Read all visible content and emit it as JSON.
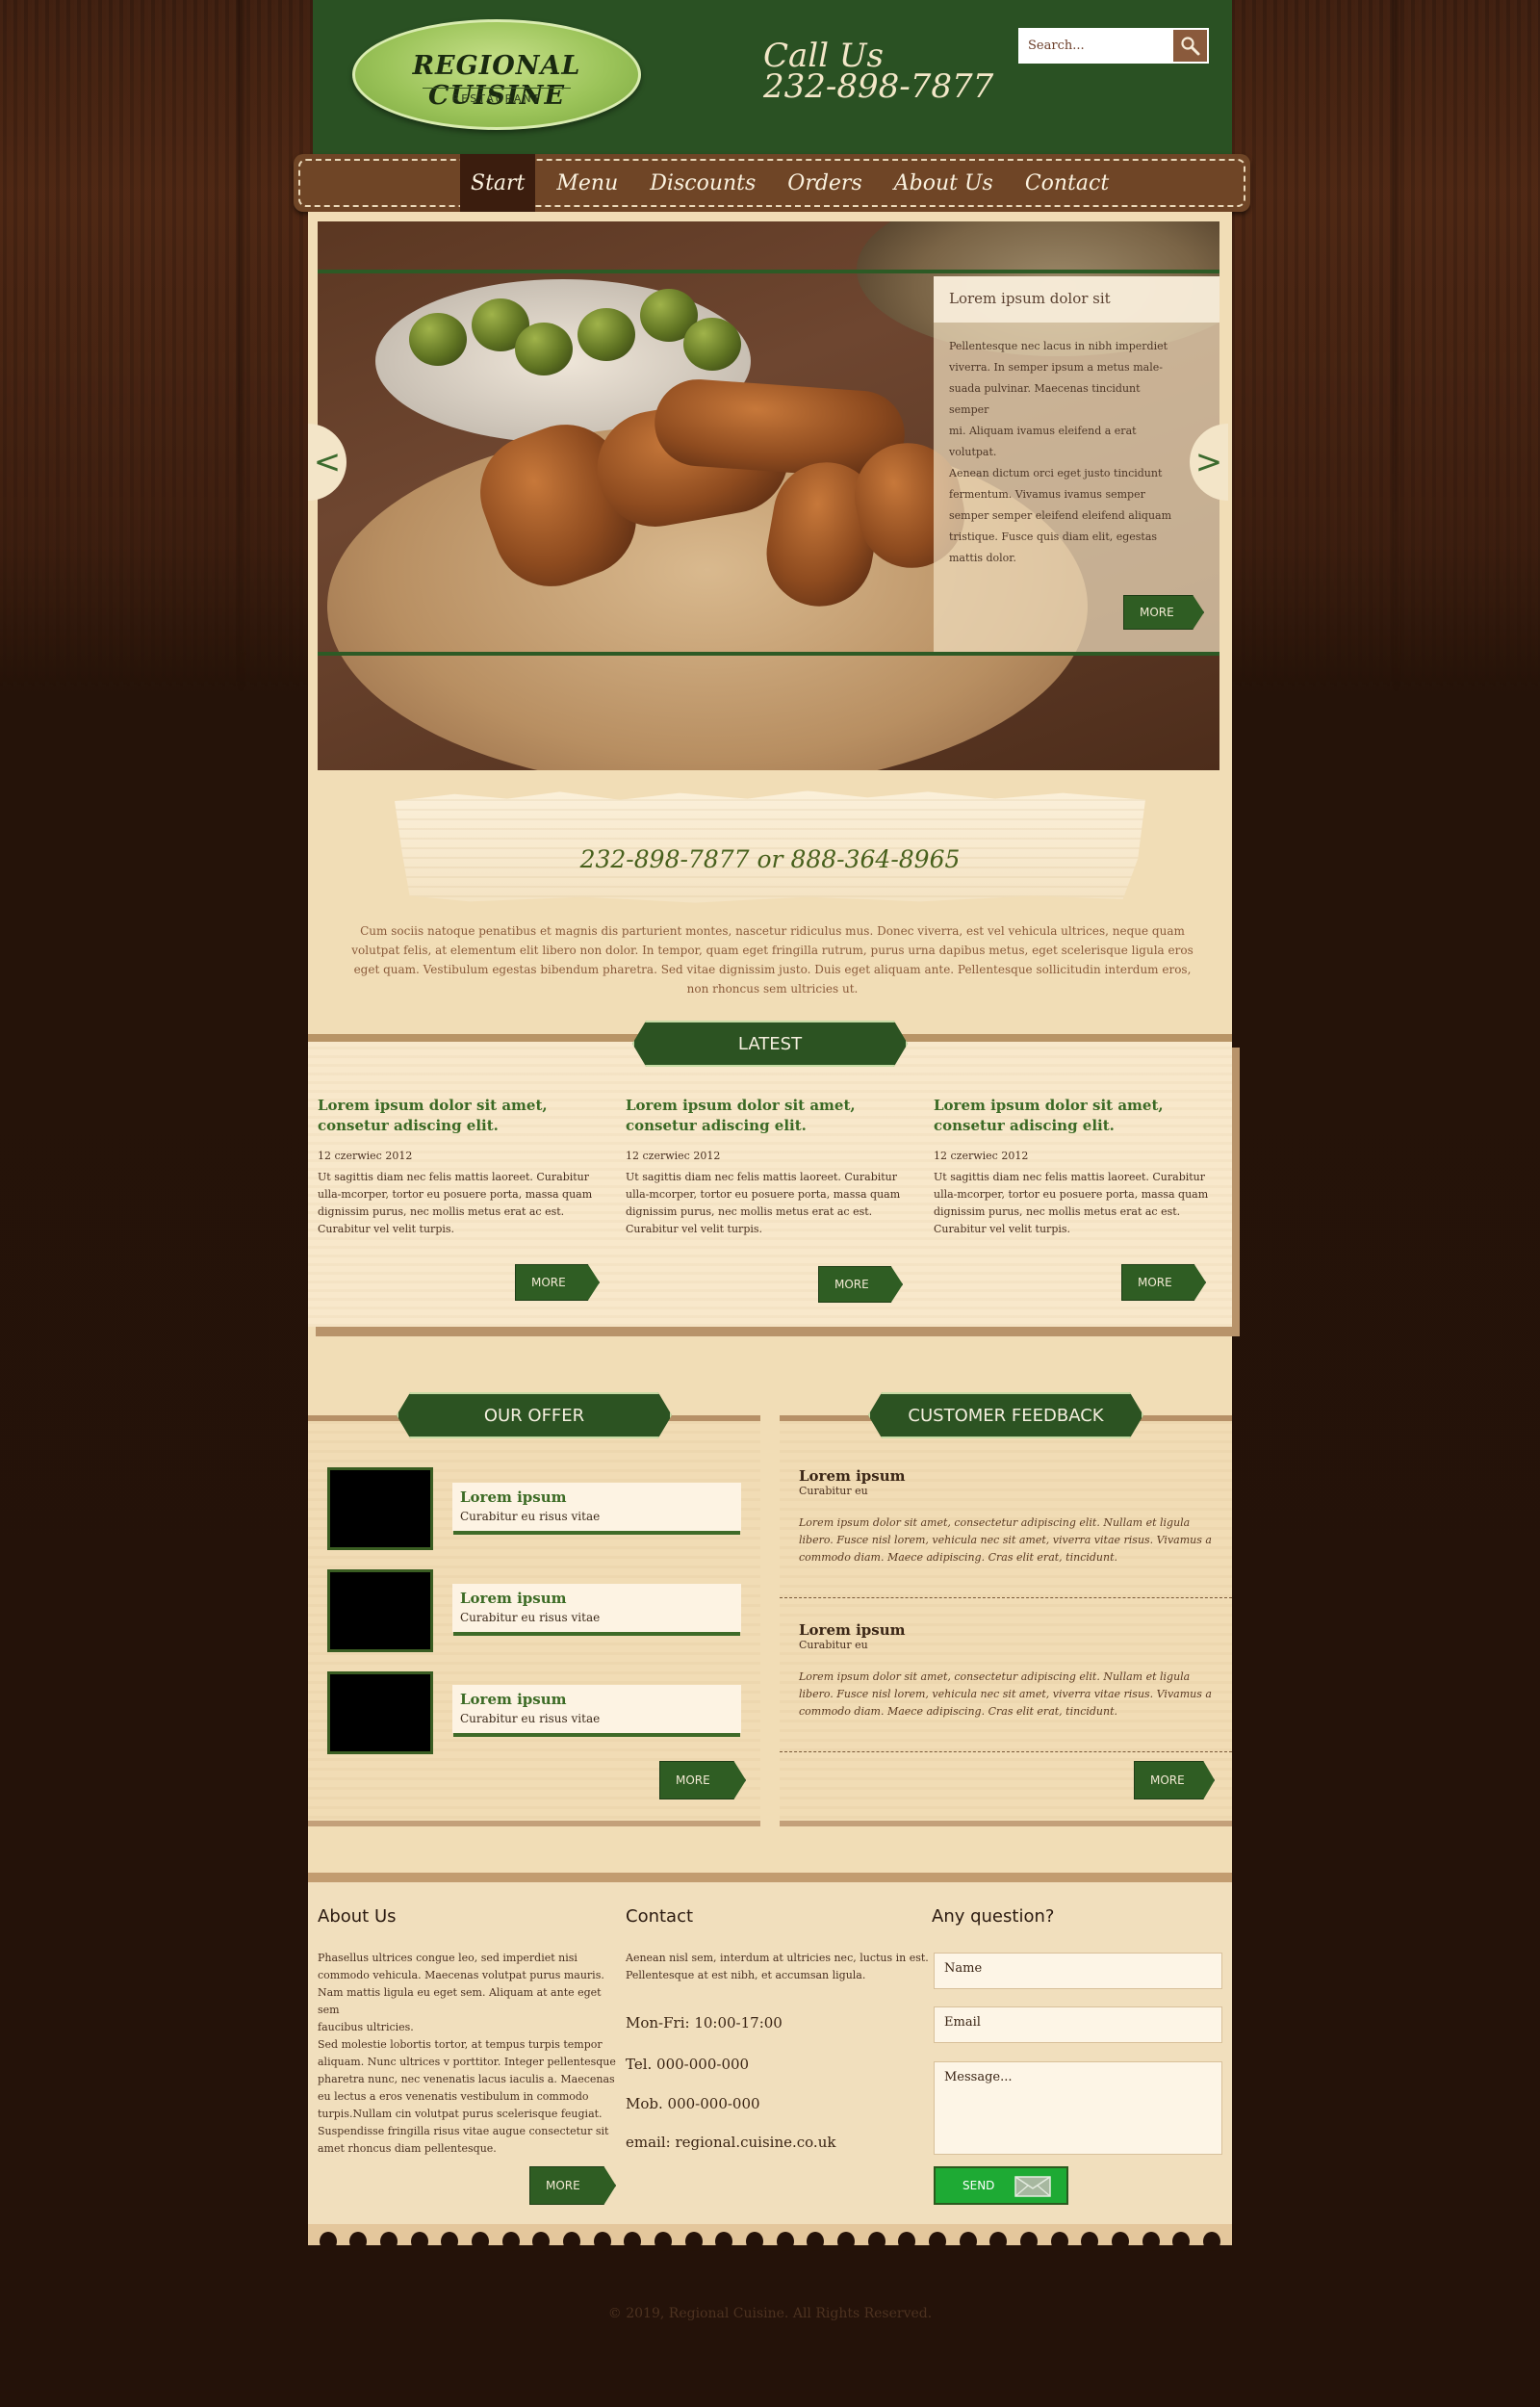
{
  "brand": {
    "title": "REGIONAL CUISINE",
    "subtitle": "RESTAURANT"
  },
  "header": {
    "call_label": "Call Us",
    "call_number": "232-898-7877"
  },
  "search": {
    "placeholder": "Search..."
  },
  "nav": {
    "items": [
      "Start",
      "Menu",
      "Discounts",
      "Orders",
      "About Us",
      "Contact"
    ],
    "active": "Start"
  },
  "slider": {
    "caption_title": "Lorem ipsum dolor sit",
    "caption_text": "Pellentesque nec lacus in nibh imperdiet\nviverra. In semper ipsum a metus male-\nsuada pulvinar. Maecenas tincidunt semper\nmi. Aliquam ivamus eleifend a erat\nvolutpat.\nAenean dictum orci eget justo tincidunt\nfermentum. Vivamus ivamus semper\nsemper semper  eleifend eleifend aliquam\ntristique. Fusce quis diam elit, egestas\nmattis dolor.",
    "more_label": "MORE",
    "prev_glyph": "<",
    "next_glyph": ">"
  },
  "phones": "232-898-7877 or 888-364-8965",
  "intro": "Cum sociis natoque penatibus et magnis dis parturient montes, nascetur ridiculus mus. Donec viverra, est vel vehicula ultrices, neque quam volutpat felis, at elementum elit libero non dolor. In tempor, quam eget fringilla rutrum, purus urna dapibus metus, eget scelerisque ligula eros eget quam. Vestibulum egestas bibendum pharetra. Sed vitae dignissim justo. Duis eget aliquam ante. Pellentesque sollicitudin interdum eros, non rhoncus sem ultricies ut.",
  "latest": {
    "heading": "LATEST",
    "posts": [
      {
        "title": "Lorem ipsum dolor sit amet, consetur adiscing elit.",
        "date": "12 czerwiec 2012",
        "text": "Ut sagittis diam nec felis mattis laoreet. Curabitur ulla-mcorper, tortor eu posuere porta, massa quam dignissim purus, nec mollis metus erat ac est. Curabitur vel velit turpis.",
        "more": "MORE"
      },
      {
        "title": "Lorem ipsum dolor sit amet, consetur adiscing elit.",
        "date": "12 czerwiec 2012",
        "text": "Ut sagittis diam nec felis mattis laoreet. Curabitur ulla-mcorper, tortor eu posuere porta, massa quam dignissim purus, nec mollis metus erat ac est. Curabitur vel velit turpis.",
        "more": "MORE"
      },
      {
        "title": "Lorem ipsum dolor sit amet, consetur adiscing elit.",
        "date": "12 czerwiec 2012",
        "text": "Ut sagittis diam nec felis mattis laoreet. Curabitur ulla-mcorper, tortor eu posuere porta, massa quam dignissim purus, nec mollis metus erat ac est. Curabitur vel velit turpis.",
        "more": "MORE"
      }
    ]
  },
  "offer": {
    "heading": "OUR OFFER",
    "items": [
      {
        "title": "Lorem ipsum",
        "sub": "Curabitur eu risus vitae"
      },
      {
        "title": "Lorem ipsum",
        "sub": "Curabitur eu risus vitae"
      },
      {
        "title": "Lorem ipsum",
        "sub": "Curabitur eu risus vitae"
      }
    ],
    "more": "MORE"
  },
  "feedback": {
    "heading": "CUSTOMER FEEDBACK",
    "items": [
      {
        "name": "Lorem ipsum",
        "role": "Curabitur eu",
        "quote": "Lorem ipsum dolor sit amet, consectetur adipiscing elit. Nullam et ligula libero. Fusce nisl lorem, vehicula nec sit amet, viverra vitae risus. Vivamus a commodo diam. Maece adipiscing. Cras elit erat, tincidunt."
      },
      {
        "name": "Lorem ipsum",
        "role": "Curabitur eu",
        "quote": "Lorem ipsum dolor sit amet, consectetur adipiscing elit. Nullam et ligula libero. Fusce nisl lorem, vehicula nec sit amet, viverra vitae risus. Vivamus a commodo diam. Maece adipiscing. Cras elit erat, tincidunt."
      }
    ],
    "more": "MORE"
  },
  "footer": {
    "about_heading": "About Us",
    "about_text": "Phasellus ultrices congue leo, sed imperdiet nisi\ncommodo vehicula. Maecenas volutpat purus mauris.\nNam mattis ligula eu eget sem. Aliquam at ante eget sem\nfaucibus ultricies.\nSed molestie lobortis tortor, at tempus turpis tempor\naliquam. Nunc ultrices v porttitor. Integer pellentesque\npharetra nunc, nec venenatis lacus iaculis a. Maecenas\neu lectus a eros venenatis vestibulum in commodo\nturpis.Nullam cin volutpat purus scelerisque feugiat.\nSuspendisse fringilla risus vitae augue consectetur sit\namet rhoncus diam pellentesque.",
    "about_more": "MORE",
    "contact_heading": "Contact",
    "contact_text": "Aenean nisl sem, interdum at ultricies nec, luctus in est.\nPellentesque at est nibh, et accumsan ligula.",
    "hours": "Mon-Fri: 10:00-17:00",
    "tel": "Tel. 000-000-000",
    "mob": "Mob. 000-000-000",
    "email": "email: regional.cuisine.co.uk",
    "question_heading": "Any question?",
    "name_placeholder": "Name",
    "email_placeholder": "Email",
    "message_placeholder": "Message...",
    "send_label": "SEND"
  },
  "copyright": "© 2019, Regional Cuisine. All Rights Reserved.",
  "colors": {
    "header_green": "#2a5123",
    "nav_brown": "#6f4526",
    "accent_green": "#2f5d23",
    "page_cream": "#f1ddb6",
    "send_green": "#1eaa34"
  }
}
